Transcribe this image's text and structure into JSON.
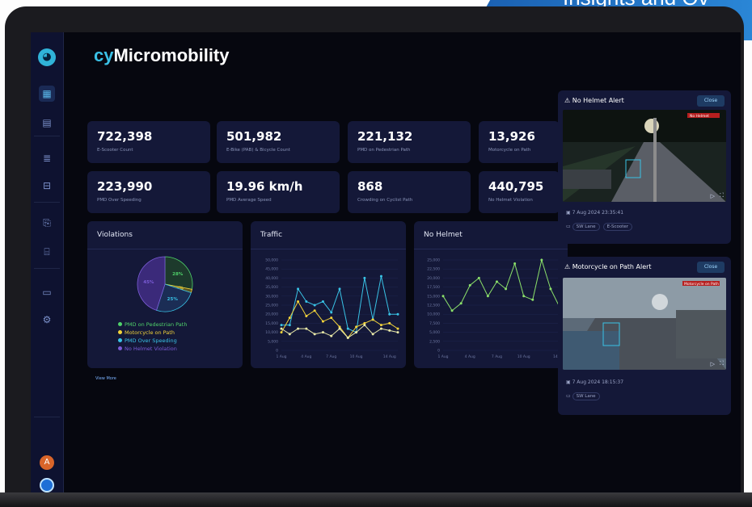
{
  "banner": {
    "text": "Insights and Ov"
  },
  "app": {
    "title_prefix": "cy",
    "title_suffix": "Micromobility"
  },
  "sidebar": {
    "avatar_initial": "A"
  },
  "stats": [
    {
      "value": "722,398",
      "label": "E-Scooter Count"
    },
    {
      "value": "501,982",
      "label": "E-Bike (PAB) & Bicycle Count"
    },
    {
      "value": "221,132",
      "label": "PMD on Pedestrian Path"
    },
    {
      "value": "13,926",
      "label": "Motorcycle on Path"
    },
    {
      "value": "223,990",
      "label": "PMD Over Speeding"
    },
    {
      "value": "19.96 km/h",
      "label": "PMD Average Speed"
    },
    {
      "value": "868",
      "label": "Crowding on Cyclist Path"
    },
    {
      "value": "440,795",
      "label": "No Helmet Violation"
    }
  ],
  "violations": {
    "title": "Violations",
    "legend": [
      {
        "label": "PMD on Pedestrian Path",
        "color": "#4fd16a"
      },
      {
        "label": "Motorcycle on Path",
        "color": "#f2d33a"
      },
      {
        "label": "PMD Over Speeding",
        "color": "#39c3e6"
      },
      {
        "label": "No Helmet Violation",
        "color": "#7b5cd6"
      }
    ],
    "view_more": "View More"
  },
  "traffic": {
    "title": "Traffic"
  },
  "helmet": {
    "title": "No Helmet"
  },
  "chart_data": [
    {
      "type": "pie",
      "title": "Violations",
      "categories": [
        "PMD on Pedestrian Path",
        "Motorcycle on Path",
        "PMD Over Speeding",
        "No Helmet Violation"
      ],
      "values": [
        28,
        2,
        25,
        45
      ],
      "labels": [
        "28%",
        "2%",
        "25%",
        "45%"
      ]
    },
    {
      "type": "line",
      "title": "Traffic",
      "categories": [
        "1 Aug",
        "2 Aug",
        "3 Aug",
        "4 Aug",
        "5 Aug",
        "6 Aug",
        "7 Aug",
        "8 Aug",
        "9 Aug",
        "10 Aug",
        "11 Aug",
        "12 Aug",
        "13 Aug",
        "14 Aug",
        "15 Aug"
      ],
      "tick_labels": [
        "1 Aug",
        "4 Aug",
        "7 Aug",
        "10 Aug",
        "14 Aug"
      ],
      "y_ticks": [
        "0",
        "5,000",
        "10,000",
        "15,000",
        "20,000",
        "25,000",
        "30,000",
        "35,000",
        "40,000",
        "45,000",
        "50,000"
      ],
      "ylim": [
        0,
        50000
      ],
      "series": [
        {
          "color": "#39c3e6",
          "values": [
            14000,
            14000,
            34000,
            27000,
            25000,
            27000,
            21000,
            34000,
            12000,
            10000,
            40000,
            17000,
            41000,
            20000,
            20000
          ]
        },
        {
          "color": "#f2d33a",
          "values": [
            10000,
            18000,
            27000,
            19000,
            22000,
            16000,
            18000,
            13000,
            7000,
            13000,
            15000,
            17000,
            14000,
            15000,
            12000
          ]
        },
        {
          "color": "#e9e9a8",
          "values": [
            12000,
            9000,
            12000,
            12000,
            9000,
            10000,
            8000,
            12000,
            7000,
            10000,
            14000,
            9000,
            12000,
            11000,
            10000
          ]
        }
      ]
    },
    {
      "type": "line",
      "title": "No Helmet",
      "categories": [
        "1 Aug",
        "2 Aug",
        "3 Aug",
        "4 Aug",
        "5 Aug",
        "6 Aug",
        "7 Aug",
        "8 Aug",
        "9 Aug",
        "10 Aug",
        "11 Aug",
        "12 Aug",
        "13 Aug",
        "14 Aug"
      ],
      "tick_labels": [
        "1 Aug",
        "4 Aug",
        "7 Aug",
        "10 Aug",
        "14 Aug"
      ],
      "y_ticks": [
        "0",
        "2,500",
        "5,000",
        "7,500",
        "10,000",
        "12,500",
        "15,000",
        "17,500",
        "20,000",
        "22,500",
        "25,000"
      ],
      "ylim": [
        0,
        25000
      ],
      "series": [
        {
          "color": "#8be06a",
          "values": [
            15000,
            11000,
            13000,
            18000,
            20000,
            15000,
            19000,
            17000,
            24000,
            15000,
            14000,
            25000,
            17000,
            12000
          ]
        }
      ]
    }
  ],
  "alerts": [
    {
      "title": "No Helmet Alert",
      "close": "Close",
      "timestamp": "7 Aug 2024 23:35:41",
      "tags": [
        "SW Lane",
        "E-Scooter"
      ],
      "cam_label": "No Helmet"
    },
    {
      "title": "Motorcycle on Path Alert",
      "close": "Close",
      "timestamp": "7 Aug 2024 18:15:37",
      "tags": [
        "SW Lane"
      ],
      "cam_label": "Motorcycle on Path"
    }
  ]
}
